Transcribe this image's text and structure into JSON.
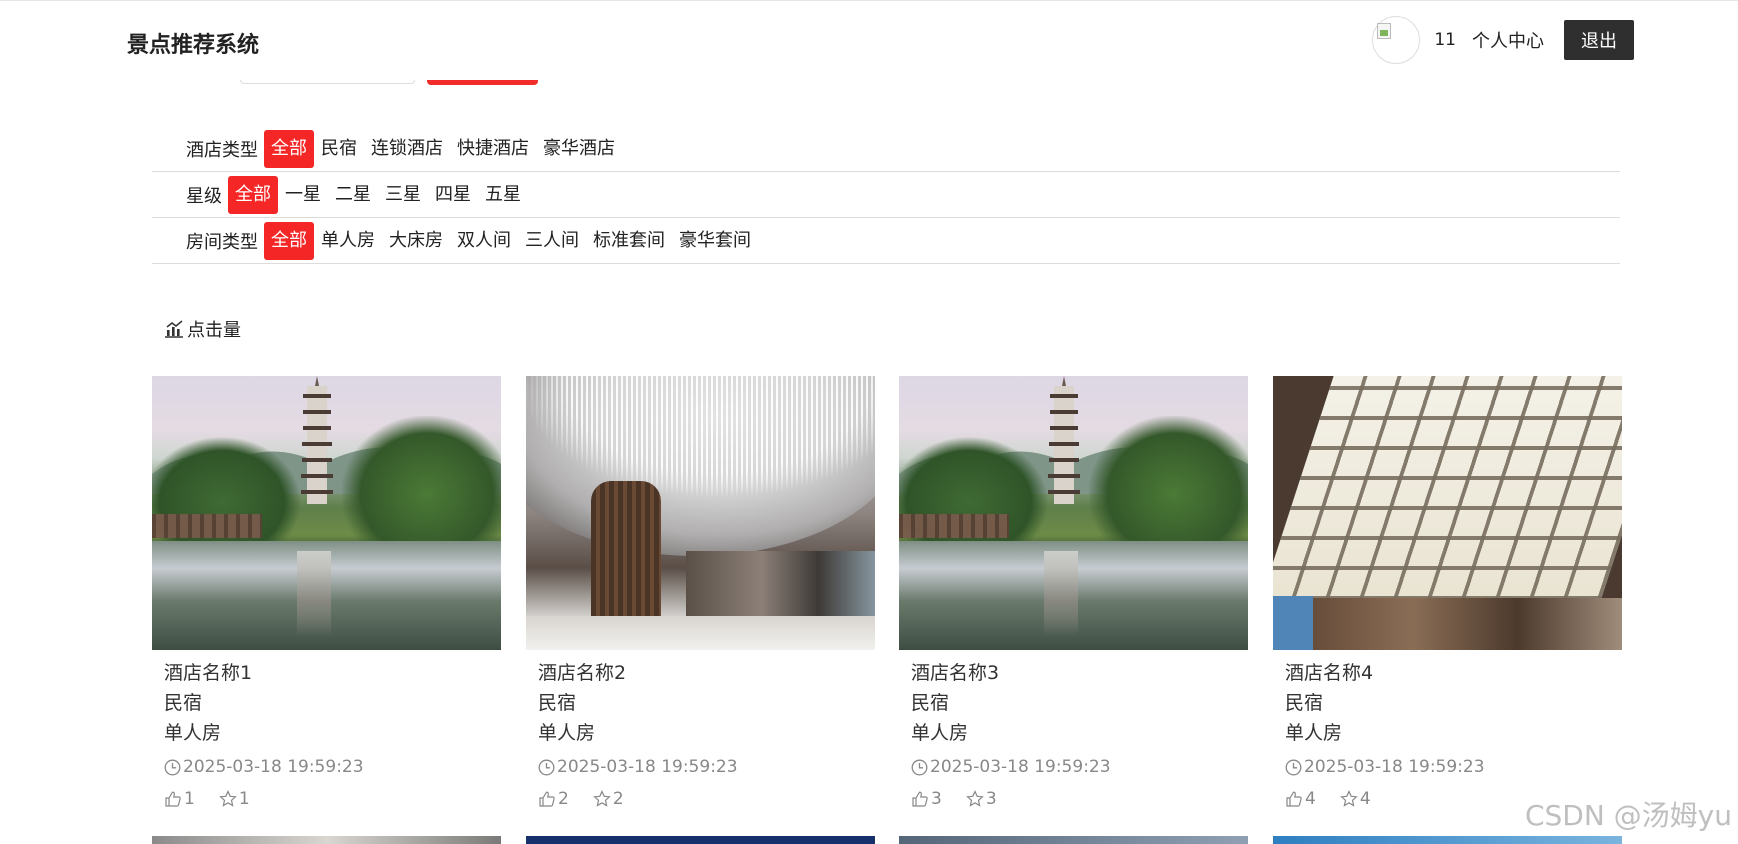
{
  "header": {
    "title": "景点推荐系统",
    "username": "11",
    "user_center_label": "个人中心",
    "logout_label": "退出"
  },
  "filters": [
    {
      "label": "酒店类型",
      "options": [
        "全部",
        "民宿",
        "连锁酒店",
        "快捷酒店",
        "豪华酒店"
      ],
      "active": "全部"
    },
    {
      "label": "星级",
      "options": [
        "全部",
        "一星",
        "二星",
        "三星",
        "四星",
        "五星"
      ],
      "active": "全部"
    },
    {
      "label": "房间类型",
      "options": [
        "全部",
        "单人房",
        "大床房",
        "双人间",
        "三人间",
        "标准套间",
        "豪华套间"
      ],
      "active": "全部"
    }
  ],
  "sort": {
    "label": "点击量",
    "icon": "bar-chart-icon"
  },
  "cards": [
    {
      "name": "酒店名称1",
      "type": "民宿",
      "room": "单人房",
      "time": "2025-03-18 19:59:23",
      "likes": "1",
      "favorites": "1",
      "image": "pagoda-lake"
    },
    {
      "name": "酒店名称2",
      "type": "民宿",
      "room": "单人房",
      "time": "2025-03-18 19:59:23",
      "likes": "2",
      "favorites": "2",
      "image": "lobby-chandelier"
    },
    {
      "name": "酒店名称3",
      "type": "民宿",
      "room": "单人房",
      "time": "2025-03-18 19:59:23",
      "likes": "3",
      "favorites": "3",
      "image": "pagoda-lake"
    },
    {
      "name": "酒店名称4",
      "type": "民宿",
      "room": "单人房",
      "time": "2025-03-18 19:59:23",
      "likes": "4",
      "favorites": "4",
      "image": "ceiling-hall"
    }
  ],
  "watermark": "CSDN @汤姆yu",
  "colors": {
    "accent": "#f52626",
    "logout_bg": "#2f2f2f",
    "muted_text": "#888888"
  }
}
